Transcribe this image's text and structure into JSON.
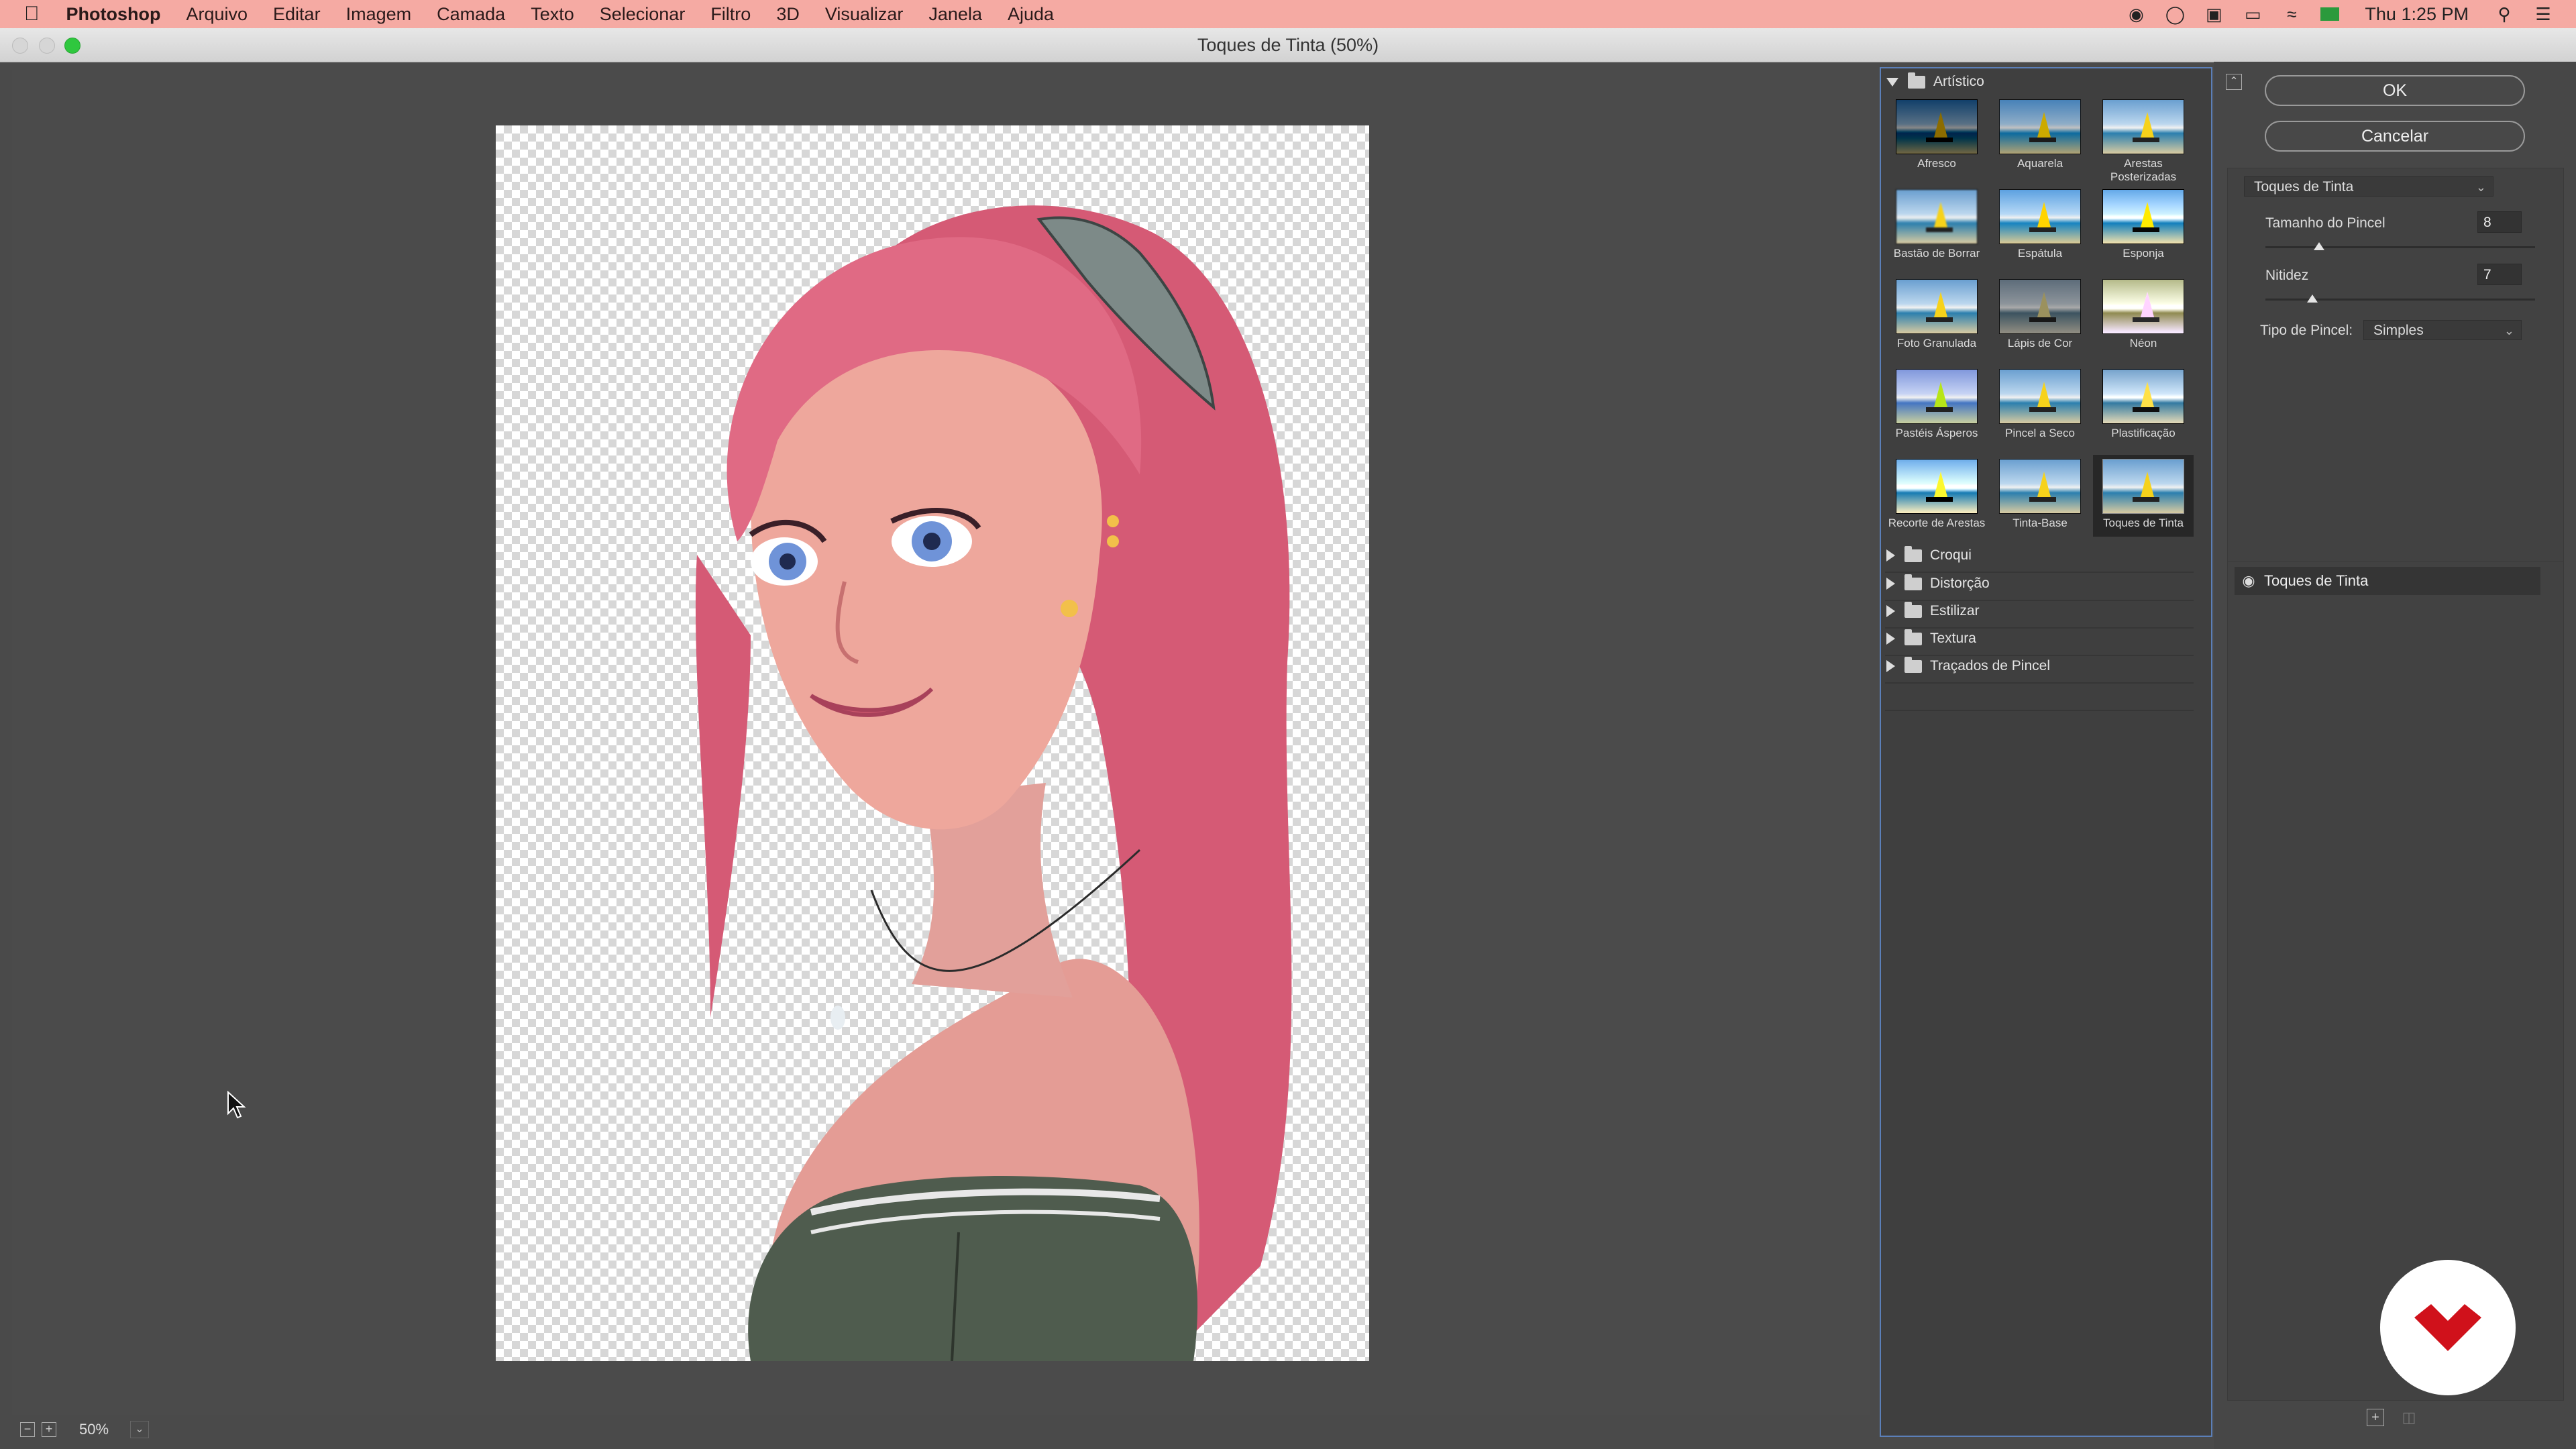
{
  "menubar": {
    "apple": "",
    "app_name": "Photoshop",
    "items": [
      "Arquivo",
      "Editar",
      "Imagem",
      "Camada",
      "Texto",
      "Selecionar",
      "Filtro",
      "3D",
      "Visualizar",
      "Janela",
      "Ajuda"
    ],
    "clock": "Thu 1:25 PM",
    "status_icons": [
      "adobe-cc-icon",
      "creative-cloud-icon",
      "extension-icon",
      "screen-mirroring-icon",
      "wifi-icon",
      "flag-icon",
      "search-icon",
      "list-icon"
    ]
  },
  "window": {
    "title": "Toques de Tinta (50%)"
  },
  "canvas": {
    "zoom": "50%"
  },
  "gallery": {
    "open_folder": "Artístico",
    "filters": [
      {
        "label": "Afresco"
      },
      {
        "label": "Aquarela"
      },
      {
        "label": "Arestas Posterizadas"
      },
      {
        "label": "Bastão de Borrar"
      },
      {
        "label": "Espátula"
      },
      {
        "label": "Esponja"
      },
      {
        "label": "Foto Granulada"
      },
      {
        "label": "Lápis de Cor"
      },
      {
        "label": "Néon"
      },
      {
        "label": "Pastéis Ásperos"
      },
      {
        "label": "Pincel a Seco"
      },
      {
        "label": "Plastificação"
      },
      {
        "label": "Recorte de Arestas"
      },
      {
        "label": "Tinta-Base"
      },
      {
        "label": "Toques de Tinta"
      }
    ],
    "selected_filter": "Toques de Tinta",
    "closed_folders": [
      "Croqui",
      "Distorção",
      "Estilizar",
      "Textura",
      "Traçados de Pincel"
    ]
  },
  "panel": {
    "ok_label": "OK",
    "cancel_label": "Cancelar",
    "filter_select": "Toques de Tinta",
    "brush_size_label": "Tamanho do Pincel",
    "brush_size_value": "8",
    "brush_size_level": 0.2,
    "sharpness_label": "Nitidez",
    "sharpness_value": "7",
    "sharpness_level": 0.175,
    "brush_type_label": "Tipo de Pincel:",
    "brush_type_value": "Simples",
    "effect_layer": "Toques de Tinta"
  },
  "colors": {
    "menubar": "#f5aaa3",
    "gallery_border": "#5b7fb8",
    "badge_logo": "#d0111b"
  }
}
